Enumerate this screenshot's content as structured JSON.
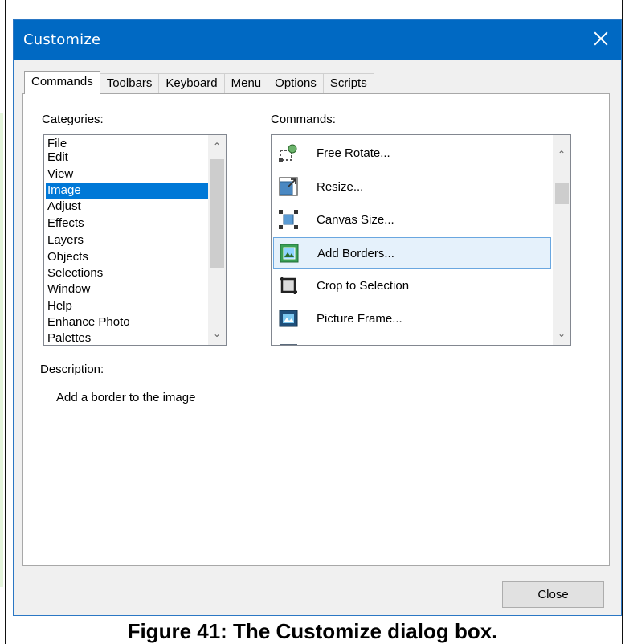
{
  "window": {
    "title": "Customize"
  },
  "tabs": [
    "Commands",
    "Toolbars",
    "Keyboard",
    "Menu",
    "Options",
    "Scripts"
  ],
  "active_tab": "Commands",
  "categories": {
    "label": "Categories:",
    "items": [
      "File",
      "Edit",
      "View",
      "Image",
      "Adjust",
      "Effects",
      "Layers",
      "Objects",
      "Selections",
      "Window",
      "Help",
      "Enhance Photo",
      "Palettes"
    ],
    "selected": "Image"
  },
  "commands": {
    "label": "Commands:",
    "items": [
      {
        "label": "Free Rotate...",
        "icon": "free-rotate-icon"
      },
      {
        "label": "Resize...",
        "icon": "resize-icon"
      },
      {
        "label": "Canvas Size...",
        "icon": "canvas-size-icon"
      },
      {
        "label": "Add Borders...",
        "icon": "add-borders-icon"
      },
      {
        "label": "Crop to Selection",
        "icon": "crop-icon"
      },
      {
        "label": "Picture Frame...",
        "icon": "picture-frame-icon"
      }
    ],
    "selected": "Add Borders..."
  },
  "description": {
    "label": "Description:",
    "text": "Add a border to the image"
  },
  "buttons": {
    "close": "Close"
  },
  "caption": "Figure 41: The Customize dialog box.",
  "colors": {
    "titlebar": "#0069c3",
    "selection": "#0078d7",
    "hover_selection": "#e5f1fb"
  }
}
